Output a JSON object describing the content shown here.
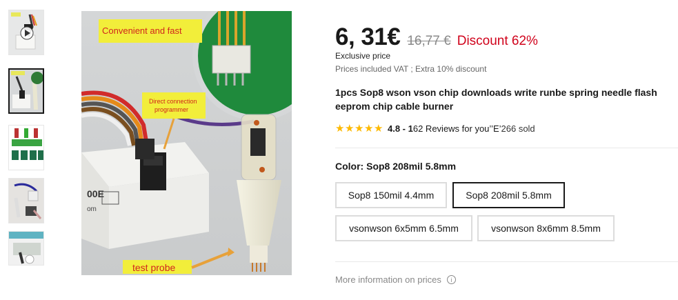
{
  "gallery": {
    "thumbnails": [
      {
        "icon": "video-play-icon",
        "has_video": true
      },
      {
        "active": true
      },
      {},
      {},
      {}
    ],
    "main_image": {
      "callouts": [
        "Convenient and fast",
        "Direct connection programmer",
        "test probe"
      ]
    }
  },
  "pricing": {
    "price": "6, 31€",
    "original_price": "16,77 €",
    "discount": "Discount 62%",
    "exclusive": "Exclusive price",
    "vat_note": "Prices included VAT ; Extra 10% discount"
  },
  "product": {
    "title": "1pcs Sop8 wson vson chip downloads write runbe spring needle flash eeprom chip cable burner",
    "rating": {
      "stars": 5,
      "score": "4.8 - 1",
      "reviews": "62 Reviews for you’’E’",
      "sold": "266 sold"
    }
  },
  "variants": {
    "label": "Color: Sop8 208mil 5.8mm",
    "options": [
      {
        "label": "Sop8 150mil 4.4mm",
        "selected": false
      },
      {
        "label": "Sop8 208mil 5.8mm",
        "selected": true
      },
      {
        "label": "vsonwson 6x5mm 6.5mm",
        "selected": false
      },
      {
        "label": "vsonwson 8x6mm 8.5mm",
        "selected": false
      }
    ]
  },
  "footer": {
    "more_info": "More information on prices"
  },
  "colors": {
    "price": "#191919",
    "discount": "#d0021b",
    "star": "#fdb901",
    "selected_border": "#191919"
  }
}
